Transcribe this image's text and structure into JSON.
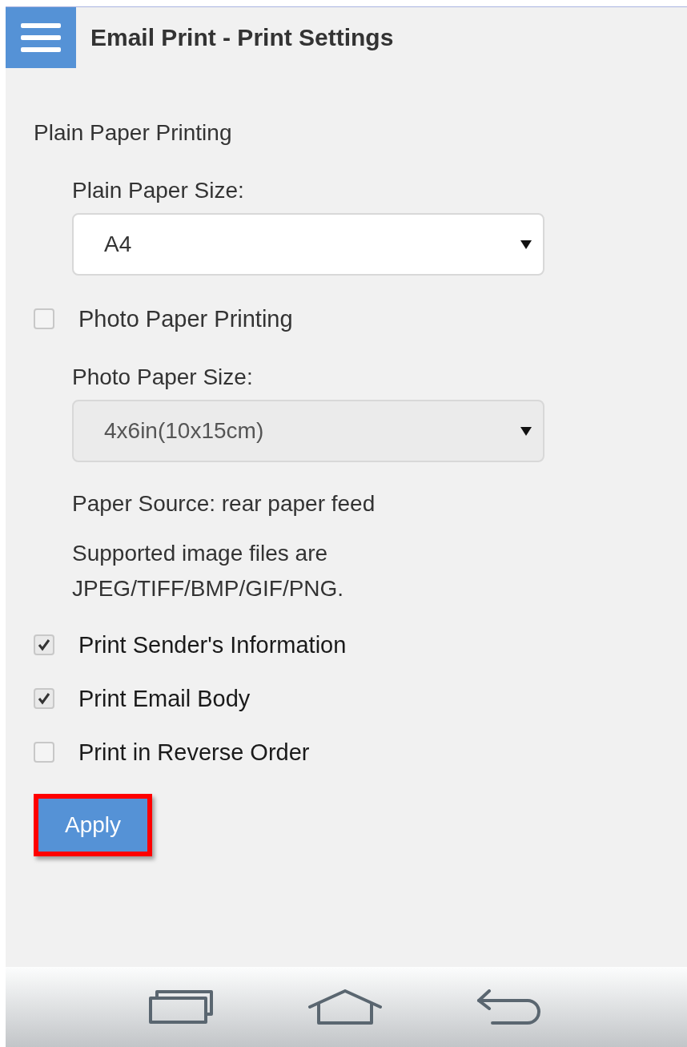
{
  "header": {
    "title": "Email Print - Print Settings"
  },
  "plain_paper": {
    "heading": "Plain Paper Printing",
    "size_label": "Plain Paper Size:",
    "size_select": {
      "value": "A4",
      "disabled": false
    }
  },
  "photo_paper": {
    "label": "Photo Paper Printing",
    "checked": false,
    "size_label": "Photo Paper Size:",
    "size_select": {
      "value": "4x6in(10x15cm)",
      "disabled": true
    },
    "paper_source": "Paper Source: rear paper feed",
    "supported_note": "Supported image files are JPEG/TIFF/BMP/GIF/PNG."
  },
  "options": [
    {
      "label": "Print Sender's Information",
      "checked": true
    },
    {
      "label": "Print Email Body",
      "checked": true
    },
    {
      "label": "Print in Reverse Order",
      "checked": false
    }
  ],
  "apply_button": {
    "label": "Apply",
    "highlighted": true
  }
}
